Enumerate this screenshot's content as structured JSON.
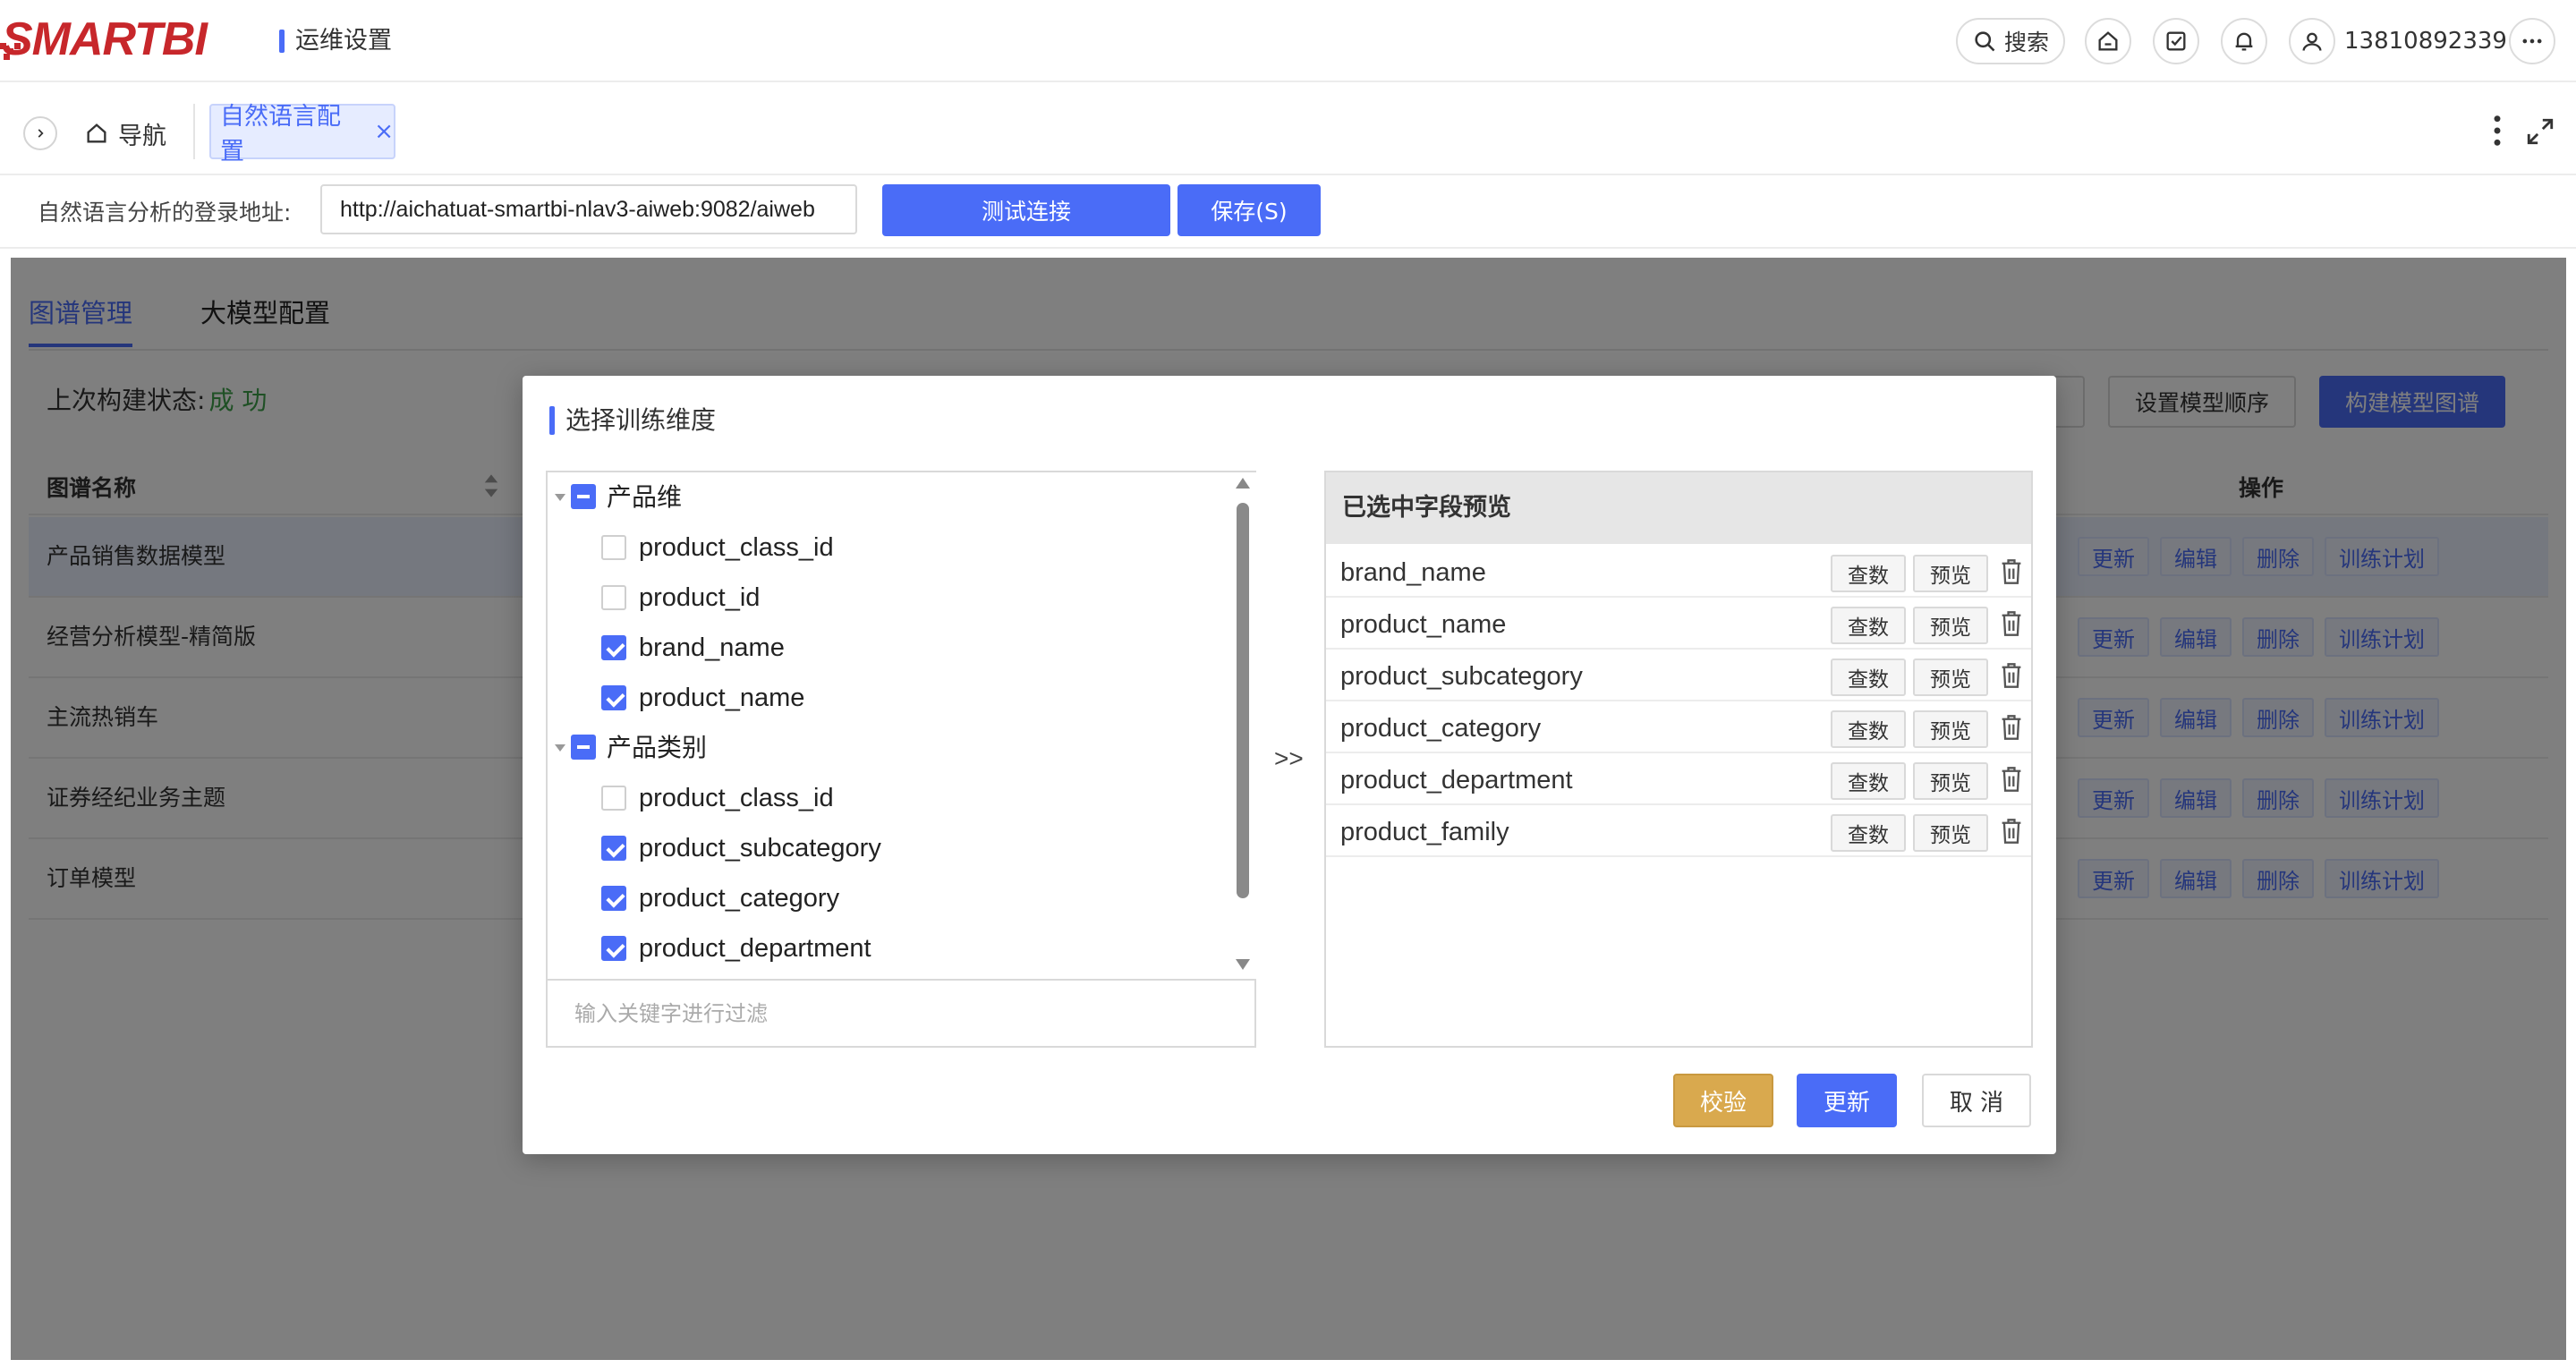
{
  "header": {
    "logo_text": "SMARTBI",
    "module_title": "运维设置",
    "search_label": "搜索",
    "user_name": "13810892339",
    "accent_color": "#4a6cf7",
    "logo_color": "#c7272b",
    "icons": [
      "search-icon",
      "home-icon",
      "task-check-icon",
      "bell-icon",
      "user-icon",
      "more-icon"
    ]
  },
  "tabbar": {
    "nav_label": "导航",
    "active_tab_label": "自然语言配置",
    "close_glyph": "×"
  },
  "address": {
    "label": "自然语言分析的登录地址:",
    "value": "http://aichatuat-smartbi-nlav3-aiweb:9082/aiweb",
    "test_button": "测试连接",
    "save_button": "保存(S)"
  },
  "main": {
    "tabs": [
      "图谱管理",
      "大模型配置"
    ],
    "build_status_label": "上次构建状态:",
    "build_status_value": "成 功",
    "set_order_button": "设置模型顺序",
    "build_button": "构建模型图谱",
    "columns": {
      "name": "图谱名称",
      "ops": "操作"
    },
    "rows": [
      {
        "name": "产品销售数据模型"
      },
      {
        "name": "经营分析模型-精简版"
      },
      {
        "name": "主流热销车"
      },
      {
        "name": "证券经纪业务主题"
      },
      {
        "name": "订单模型"
      }
    ],
    "row_ops": [
      "更新",
      "编辑",
      "删除",
      "训练计划"
    ]
  },
  "modal": {
    "title": "选择训练维度",
    "groups": [
      {
        "label": "产品维",
        "items": [
          {
            "label": "product_class_id",
            "checked": false
          },
          {
            "label": "product_id",
            "checked": false
          },
          {
            "label": "brand_name",
            "checked": true
          },
          {
            "label": "product_name",
            "checked": true
          }
        ]
      },
      {
        "label": "产品类别",
        "items": [
          {
            "label": "product_class_id",
            "checked": false
          },
          {
            "label": "product_subcategory",
            "checked": true
          },
          {
            "label": "product_category",
            "checked": true
          },
          {
            "label": "product_department",
            "checked": true
          }
        ]
      }
    ],
    "filter_placeholder": "输入关键字进行过滤",
    "transfer_glyph": ">>",
    "preview_header": "已选中字段预览",
    "selected_fields": [
      "brand_name",
      "product_name",
      "product_subcategory",
      "product_category",
      "product_department",
      "product_family"
    ],
    "query_label": "查数",
    "preview_label": "预览",
    "verify_button": "校验",
    "update_button": "更新",
    "cancel_button": "取 消",
    "verify_color": "#d9a94e"
  }
}
